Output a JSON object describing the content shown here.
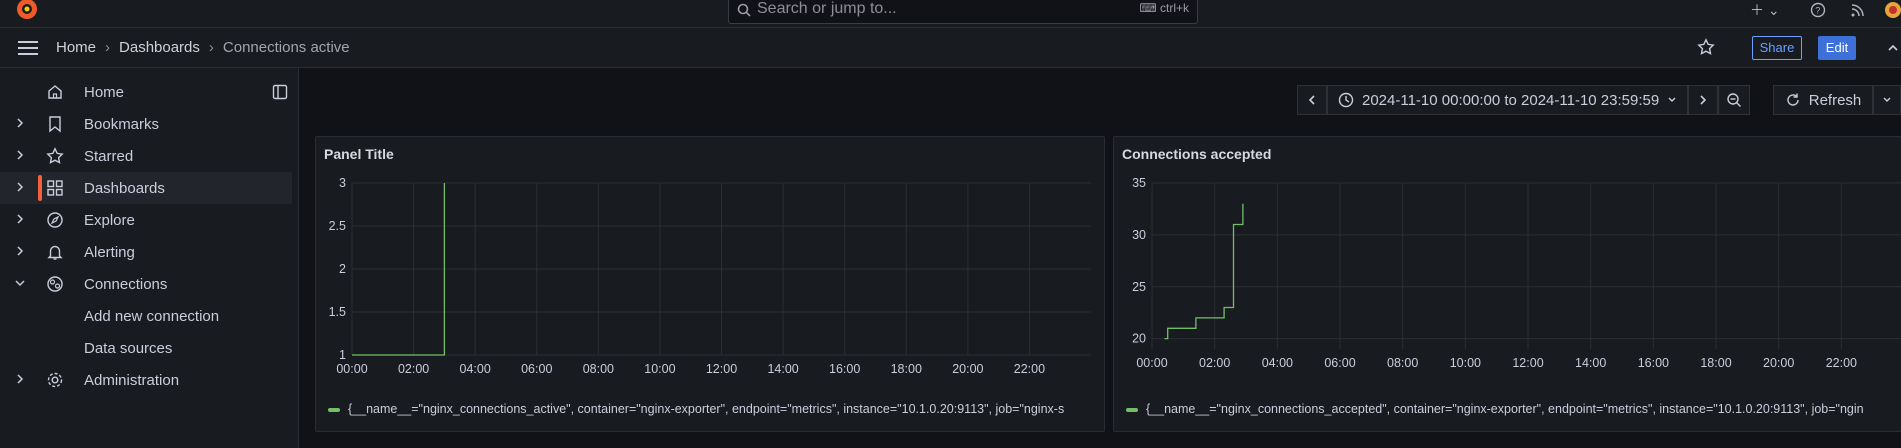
{
  "search": {
    "placeholder": "Search or jump to...",
    "shortcut": "ctrl+k"
  },
  "breadcrumb": {
    "home": "Home",
    "dashboards": "Dashboards",
    "current": "Connections active"
  },
  "toolbar": {
    "share_label": "Share",
    "edit_label": "Edit"
  },
  "sidebar": {
    "items": [
      {
        "label": "Home",
        "icon": "home-icon"
      },
      {
        "label": "Bookmarks",
        "icon": "bookmark-icon"
      },
      {
        "label": "Starred",
        "icon": "star-icon"
      },
      {
        "label": "Dashboards",
        "icon": "apps-icon"
      },
      {
        "label": "Explore",
        "icon": "compass-icon"
      },
      {
        "label": "Alerting",
        "icon": "bell-icon"
      },
      {
        "label": "Connections",
        "icon": "connections-icon"
      },
      {
        "label": "Add new connection"
      },
      {
        "label": "Data sources"
      },
      {
        "label": "Administration",
        "icon": "gear-icon"
      }
    ]
  },
  "timepicker": {
    "range": "2024-11-10 00:00:00 to 2024-11-10 23:59:59"
  },
  "refresh": {
    "label": "Refresh"
  },
  "colors": {
    "series": "#73bf69",
    "accent": "#3d71d9",
    "active_bar": "#f55f3e"
  },
  "panels": [
    {
      "title": "Panel Title",
      "legend": "{__name__=\"nginx_connections_active\", container=\"nginx-exporter\", endpoint=\"metrics\", instance=\"10.1.0.20:9113\", job=\"nginx-s"
    },
    {
      "title": "Connections accepted",
      "legend": "{__name__=\"nginx_connections_accepted\", container=\"nginx-exporter\", endpoint=\"metrics\", instance=\"10.1.0.20:9113\", job=\"ngin"
    }
  ],
  "chart_data": [
    {
      "type": "line",
      "title": "Panel Title",
      "x_ticks": [
        "00:00",
        "02:00",
        "04:00",
        "06:00",
        "08:00",
        "10:00",
        "12:00",
        "14:00",
        "16:00",
        "18:00",
        "20:00",
        "22:00"
      ],
      "y_ticks": [
        "1",
        "1.5",
        "2",
        "2.5",
        "3"
      ],
      "ylim": [
        1,
        3
      ],
      "xlim_hours": [
        0,
        24
      ],
      "series": [
        {
          "points": [
            [
              0,
              1
            ],
            [
              3.0,
              1
            ],
            [
              3.0,
              3
            ]
          ]
        }
      ]
    },
    {
      "type": "line",
      "title": "Connections accepted",
      "x_ticks": [
        "00:00",
        "02:00",
        "04:00",
        "06:00",
        "08:00",
        "10:00",
        "12:00",
        "14:00",
        "16:00",
        "18:00",
        "20:00",
        "22:00"
      ],
      "y_ticks": [
        "20",
        "25",
        "30",
        "35"
      ],
      "ylim": [
        19,
        35
      ],
      "xlim_hours": [
        0,
        24
      ],
      "series": [
        {
          "points": [
            [
              0.4,
              20
            ],
            [
              0.5,
              20
            ],
            [
              0.5,
              21
            ],
            [
              1.4,
              21
            ],
            [
              1.4,
              22
            ],
            [
              2.3,
              22
            ],
            [
              2.3,
              23
            ],
            [
              2.6,
              23
            ],
            [
              2.6,
              31
            ],
            [
              2.9,
              31
            ],
            [
              2.9,
              33
            ]
          ]
        }
      ]
    }
  ]
}
